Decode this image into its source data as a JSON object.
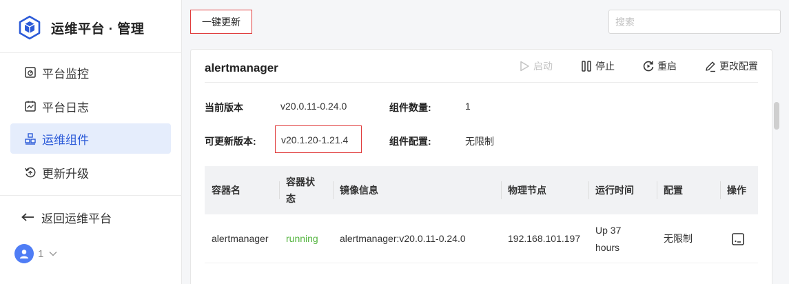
{
  "brand": {
    "title": "运维平台 · 管理",
    "logo_icon": "cube-logo-icon",
    "accent": "#2b5ad8"
  },
  "sidebar": {
    "items": [
      {
        "label": "平台监控",
        "icon": "monitor-icon",
        "active": false
      },
      {
        "label": "平台日志",
        "icon": "log-icon",
        "active": false
      },
      {
        "label": "运维组件",
        "icon": "component-icon",
        "active": true
      },
      {
        "label": "更新升级",
        "icon": "upgrade-icon",
        "active": false
      }
    ],
    "back_label": "返回运维平台",
    "user": {
      "name": "1"
    }
  },
  "toolbar": {
    "update_all_label": "一键更新",
    "search_placeholder": "搜索"
  },
  "component": {
    "name": "alertmanager",
    "actions": {
      "start": "启动",
      "stop": "停止",
      "restart": "重启",
      "config": "更改配置"
    },
    "info": {
      "current_version_label": "当前版本",
      "current_version": "v20.0.11-0.24.0",
      "count_label": "组件数量:",
      "count": "1",
      "updatable_version_label": "可更新版本:",
      "updatable_version": "v20.1.20-1.21.4",
      "config_label": "组件配置:",
      "config": "无限制"
    },
    "table": {
      "headers": [
        "容器名",
        "容器状态",
        "镜像信息",
        "物理节点",
        "运行时间",
        "配置",
        "操作"
      ],
      "rows": [
        {
          "name": "alertmanager",
          "status": "running",
          "image": "alertmanager:v20.0.11-0.24.0",
          "node": "192.168.101.197",
          "uptime": "Up 37 hours",
          "config": "无限制"
        }
      ]
    }
  },
  "colors": {
    "running": "#52b43d",
    "highlight_border": "#e03b3b",
    "active_bg": "#e5edfc"
  }
}
